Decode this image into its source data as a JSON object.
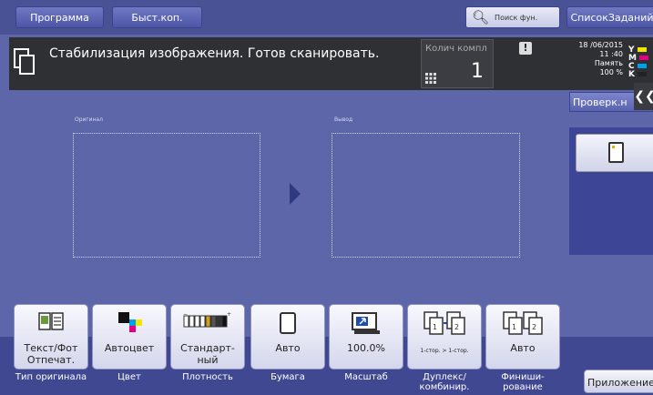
{
  "topbar": {
    "program_label": "Программа",
    "quick_copy_label": "Быст.коп.",
    "search_label": "Поиск фун.",
    "job_list_label": "СписокЗаданий"
  },
  "status": {
    "message": "Стабилизация изображения. Готов сканировать.",
    "copies_label": "Колич компл",
    "copies_value": "1",
    "date": "18 /06/2015",
    "time": "11 :40",
    "memory_label": "Память",
    "memory_value": "100 %",
    "toner": [
      {
        "letter": "Y",
        "color": "#f2e600"
      },
      {
        "letter": "M",
        "color": "#e4007f"
      },
      {
        "letter": "C",
        "color": "#00a0e9"
      },
      {
        "letter": "K",
        "color": "#222222"
      }
    ]
  },
  "side": {
    "check_label": "Проверк.н"
  },
  "preview": {
    "original_label": "Оригинал",
    "output_label": "Вывод"
  },
  "functions": [
    {
      "text": "Текст/Фот Отпечат.",
      "label": "Тип оригинала",
      "icon": "text-photo-icon"
    },
    {
      "text": "Автоцвет",
      "label": "Цвет",
      "icon": "color-icon"
    },
    {
      "text": "Стандарт-ный",
      "label": "Плотность",
      "icon": "density-icon"
    },
    {
      "text": "Авто",
      "label": "Бумага",
      "icon": "paper-icon"
    },
    {
      "text": "100.0%",
      "label": "Масштаб",
      "icon": "zoom-icon"
    },
    {
      "text": "1-стор. > 1-стор.",
      "label": "Дуплекс/ комбинир.",
      "icon": "duplex-icon"
    },
    {
      "text": "Авто",
      "label": "Финиши-рование",
      "icon": "finishing-icon"
    }
  ],
  "apps_label": "Приложение"
}
